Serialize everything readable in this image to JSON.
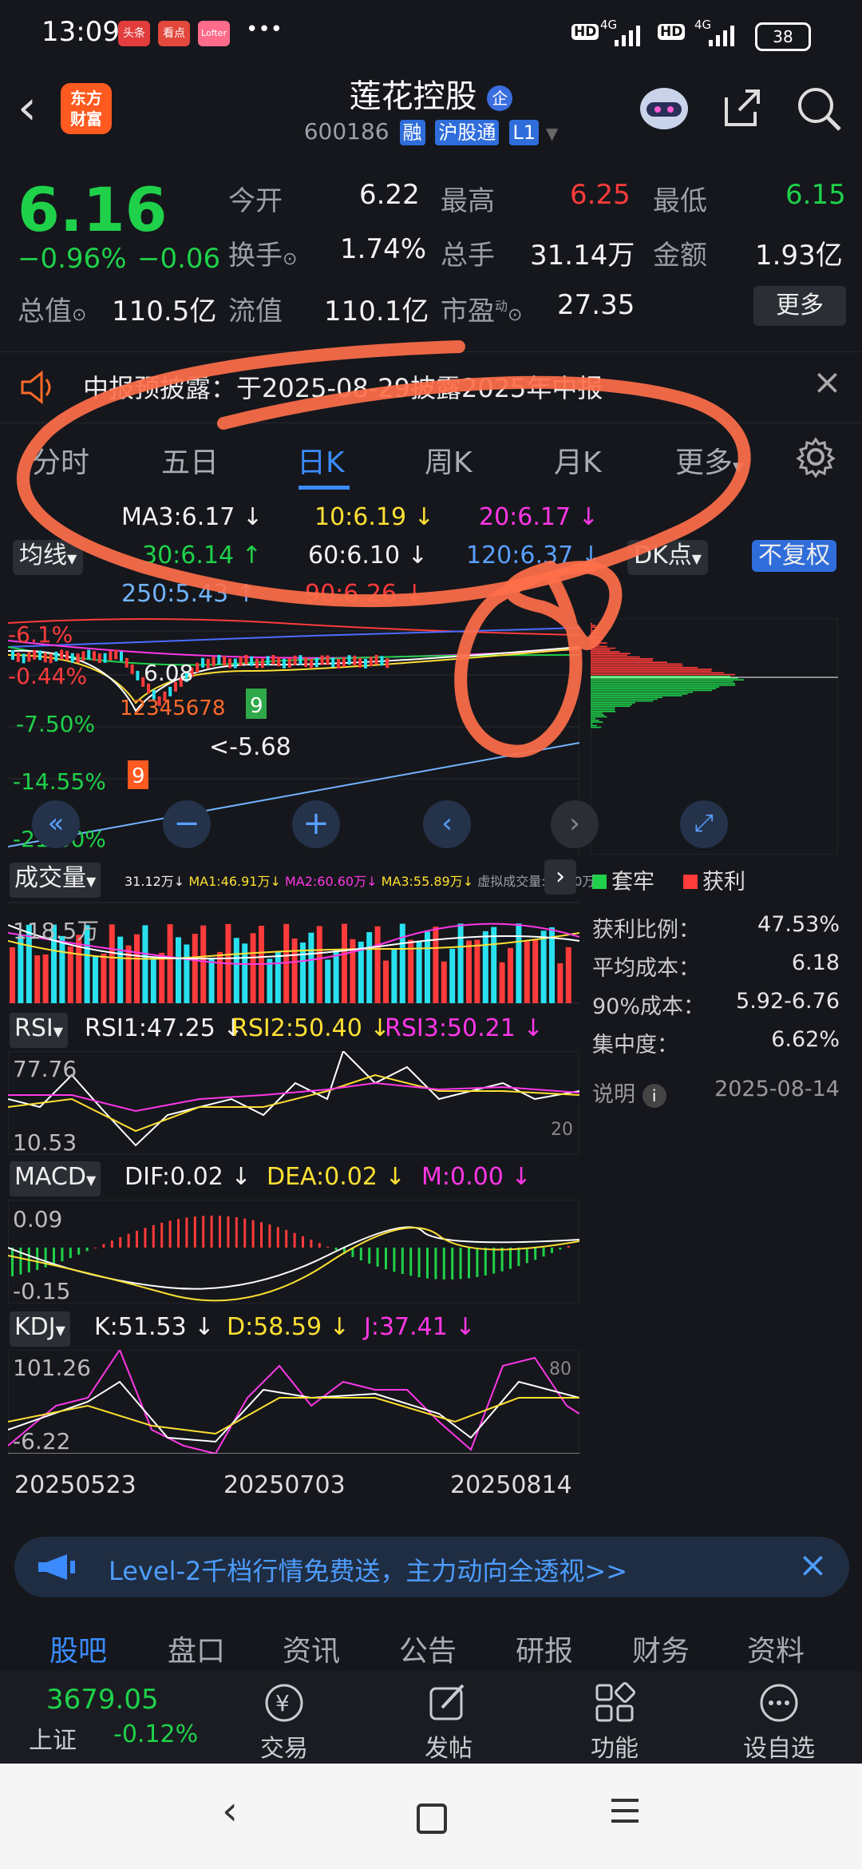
{
  "status_bar": {
    "time": "13:09",
    "apps": [
      "头条",
      "看点",
      "Lofter"
    ],
    "dots": "•••",
    "hd1": "HD",
    "net1": "4G",
    "hd2": "HD",
    "net2": "4G",
    "battery": "38"
  },
  "header": {
    "back_icon": "chevron-left-icon",
    "logo_line1": "东方",
    "logo_line2": "财富",
    "title": "莲花控股",
    "title_badge": "企",
    "code": "600186",
    "tags": [
      "融",
      "沪股通",
      "L1"
    ]
  },
  "quote": {
    "price": "6.16",
    "change_pct": "−0.96%",
    "change": "−0.06",
    "open_label": "今开",
    "open": "6.22",
    "high_label": "最高",
    "high": "6.25",
    "low_label": "最低",
    "low": "6.15",
    "turnover_label": "换手",
    "turnover": "1.74%",
    "volume_label": "总手",
    "volume": "31.14万",
    "amount_label": "金额",
    "amount": "1.93亿",
    "mktcap_label": "总值",
    "mktcap": "110.5亿",
    "float_label": "流值",
    "float": "110.1亿",
    "pe_label": "市盈",
    "pe_sup": "动",
    "pe": "27.35",
    "more": "更多"
  },
  "notice": {
    "text": "中报预披露：于2025-08-29披露2025年中报"
  },
  "tabs": [
    "分时",
    "五日",
    "日K",
    "周K",
    "月K",
    "更多"
  ],
  "active_tab": "日K",
  "ma": {
    "ma3": "MA3:6.17 ↓",
    "ma10": "10:6.19 ↓",
    "ma20": "20:6.17 ↓",
    "ma30": "30:6.14 ↑",
    "ma60": "60:6.10 ↓",
    "ma120": "120:6.37 ↓",
    "ma250": "250:5.43 ↑",
    "ma90": "90:6.26 ↓",
    "line_label": "均线",
    "dk_label": "DK点",
    "fq_label": "不复权"
  },
  "kline": {
    "pct_top": "-0.44%",
    "pct_61": "-6.1%",
    "pct_1": "-7.50%",
    "pct_2": "-14.55%",
    "pct_3": "-21.60%",
    "price_label": "6.08",
    "low_marker": "<-5.68",
    "td_marks": [
      "1",
      "2",
      "3",
      "4",
      "5",
      "6",
      "7",
      "8",
      "9"
    ]
  },
  "chips": {
    "legend_locked": "套牢",
    "legend_profit": "获利",
    "rows": [
      {
        "label": "获利比例：",
        "value": "47.53%"
      },
      {
        "label": "平均成本：",
        "value": "6.18"
      },
      {
        "label": "90%成本：",
        "value": "5.92-6.76"
      },
      {
        "label": "集中度：",
        "value": "6.62%"
      }
    ],
    "note_label": "说明",
    "date": "2025-08-14"
  },
  "volume": {
    "label": "成交量",
    "v1": "31.12万↓",
    "ma1": "MA1:46.91万↓",
    "ma2": "MA2:60.60万↓",
    "ma3": "MA3:55.89万↓",
    "virtual": "虚拟成交量:39.90万",
    "axis": "118.5万"
  },
  "rsi": {
    "label": "RSI",
    "r1": "RSI1:47.25 ↓",
    "r2": "RSI2:50.40 ↓",
    "r3": "RSI3:50.21 ↓",
    "top": "77.76",
    "bottom": "10.53",
    "right_bottom": "20"
  },
  "macd": {
    "label": "MACD",
    "dif": "DIF:0.02 ↓",
    "dea": "DEA:0.02 ↓",
    "m": "M:0.00 ↓",
    "top": "0.09",
    "bottom": "-0.15"
  },
  "kdj": {
    "label": "KDJ",
    "k": "K:51.53 ↓",
    "d": "D:58.59 ↓",
    "j": "J:37.41 ↓",
    "top": "101.26",
    "bottom": "-6.22",
    "right_top": "80"
  },
  "dates": [
    "20250523",
    "20250703",
    "20250814"
  ],
  "ad": {
    "text": "Level-2千档行情免费送，主力动向全透视>>"
  },
  "bottom_tabs": [
    "股吧",
    "盘口",
    "资讯",
    "公告",
    "研报",
    "财务",
    "资料"
  ],
  "dock": {
    "index_value": "3679.05",
    "index_name": "上证",
    "index_change": "-0.12%",
    "items": [
      "交易",
      "发帖",
      "功能",
      "设自选"
    ]
  },
  "colors": {
    "up": "#ff3b3b",
    "down": "#1fd14a",
    "accent": "#3b8bff",
    "bg": "#15171c"
  }
}
